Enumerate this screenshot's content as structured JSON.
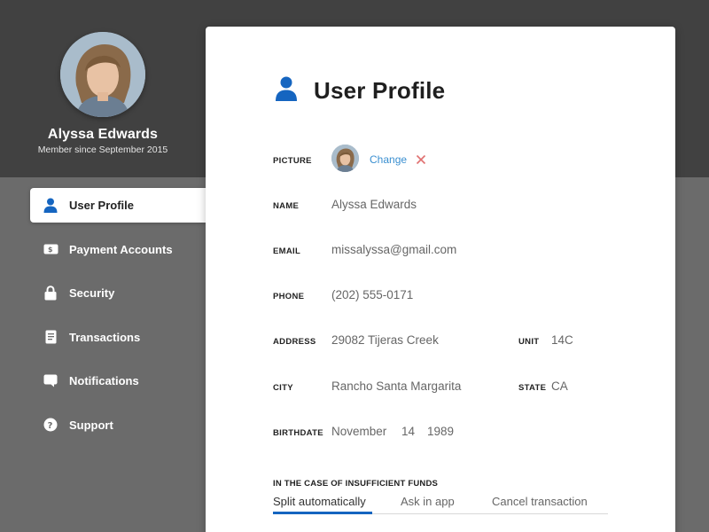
{
  "profile": {
    "name": "Alyssa Edwards",
    "member_since": "Member since September 2015"
  },
  "sidebar": {
    "items": [
      {
        "label": "User Profile",
        "icon": "user-icon",
        "active": true
      },
      {
        "label": "Payment Accounts",
        "icon": "payment-card-icon",
        "active": false
      },
      {
        "label": "Security",
        "icon": "lock-icon",
        "active": false
      },
      {
        "label": "Transactions",
        "icon": "document-icon",
        "active": false
      },
      {
        "label": "Notifications",
        "icon": "chat-bubble-icon",
        "active": false
      },
      {
        "label": "Support",
        "icon": "help-icon",
        "active": false
      }
    ]
  },
  "main": {
    "title": "User Profile",
    "picture": {
      "label": "PICTURE",
      "change_label": "Change",
      "remove_icon": "close-icon"
    },
    "name": {
      "label": "NAME",
      "value": "Alyssa Edwards"
    },
    "email": {
      "label": "EMAIL",
      "value": "missalyssa@gmail.com"
    },
    "phone": {
      "label": "PHONE",
      "value": "(202) 555-0171"
    },
    "address": {
      "label": "ADDRESS",
      "value": "29082 Tijeras Creek"
    },
    "unit": {
      "label": "UNIT",
      "value": "14C"
    },
    "city": {
      "label": "CITY",
      "value": "Rancho Santa Margarita"
    },
    "state": {
      "label": "STATE",
      "value": "CA"
    },
    "birthdate": {
      "label": "BIRTHDATE",
      "month": "November",
      "day": "14",
      "year": "1989"
    },
    "insufficient_funds": {
      "title": "IN THE CASE OF INSUFFICIENT FUNDS",
      "tabs": [
        "Split automatically",
        "Ask in app",
        "Cancel transaction"
      ],
      "selected": "Split automatically"
    }
  },
  "colors": {
    "accent": "#1565c0",
    "link": "#3a8fd0",
    "remove": "#e07070",
    "header_band": "#414141",
    "background": "#6b6b6b"
  }
}
